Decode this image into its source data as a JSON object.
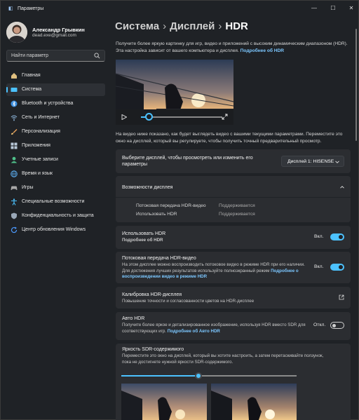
{
  "window": {
    "title": "Параметры"
  },
  "user": {
    "name": "Александр Грывкин",
    "email": "dead.exe@gmail.com"
  },
  "search": {
    "placeholder": "Найти параметр"
  },
  "sidebar": {
    "items": [
      {
        "label": "Главная",
        "icon": "home-icon",
        "color": "#e0c080"
      },
      {
        "label": "Система",
        "icon": "system-icon",
        "color": "#4cc2ff"
      },
      {
        "label": "Bluetooth и устройства",
        "icon": "bluetooth-icon",
        "color": "#3a8dde"
      },
      {
        "label": "Сеть и Интернет",
        "icon": "network-icon",
        "color": "#8fb8de"
      },
      {
        "label": "Персонализация",
        "icon": "brush-icon",
        "color": "#e8a05a"
      },
      {
        "label": "Приложения",
        "icon": "apps-icon",
        "color": "#b8c8d8"
      },
      {
        "label": "Учетные записи",
        "icon": "accounts-icon",
        "color": "#4fc08a"
      },
      {
        "label": "Время и язык",
        "icon": "globe-icon",
        "color": "#5aa8e8"
      },
      {
        "label": "Игры",
        "icon": "gamepad-icon",
        "color": "#a8a8a8"
      },
      {
        "label": "Специальные возможности",
        "icon": "accessibility-icon",
        "color": "#4cc2ff"
      },
      {
        "label": "Конфиденциальность и защита",
        "icon": "shield-icon",
        "color": "#9aa8b8"
      },
      {
        "label": "Центр обновления Windows",
        "icon": "update-icon",
        "color": "#4c9aff"
      }
    ],
    "active_index": 1
  },
  "breadcrumb": {
    "part1": "Система",
    "sep1": "›",
    "part2": "Дисплей",
    "sep2": "›",
    "part3": "HDR"
  },
  "intro": {
    "text": "Получите более яркую картинку для игр, видео и приложений с высоким динамическим диапазоном (HDR). Эта настройка зависит от вашего компьютера и дисплея.",
    "link": "Подробнее об HDR"
  },
  "video": {
    "progress": 0.1
  },
  "preview_text": "На видео ниже показано, как будет выглядеть видео с вашими текущими параметрами. Переместите это окно на дисплей, который вы регулируете, чтобы получить точный предварительный просмотр.",
  "display_select": {
    "label": "Выберите дисплей, чтобы просмотреть или изменить его параметры",
    "value": "Дисплей 1: HISENSE"
  },
  "capabilities": {
    "title": "Возможности дисплея",
    "rows": [
      {
        "label": "Потоковая передача HDR-видео",
        "value": "Поддерживается"
      },
      {
        "label": "Использовать HDR",
        "value": "Поддерживается"
      }
    ]
  },
  "use_hdr": {
    "title": "Использовать HDR",
    "link": "Подробнее об HDR",
    "state": "Вкл.",
    "on": true
  },
  "hdr_stream": {
    "title": "Потоковая передача HDR-видео",
    "desc": "На этом дисплее можно воспроизводить потоковое видео в режиме HDR при его наличии. Для достижения лучших результатов используйте полноэкранный режим",
    "link": "Подробнее о воспроизведении видео в режиме HDR",
    "state": "Вкл.",
    "on": true
  },
  "calibration": {
    "title": "Калибровка HDR-дисплея",
    "desc": "Повышение точности и согласованности цветов на HDR-дисплее",
    "icon": "external-link-icon"
  },
  "auto_hdr": {
    "title": "Авто HDR",
    "desc": "Получите более яркое и детализированное изображение, используя HDR вместо SDR для соответствующих игр.",
    "link": "Подробнее об Авто HDR",
    "state": "Откл.",
    "on": false
  },
  "sdr": {
    "title": "Яркость SDR-содержимого",
    "desc": "Переместите это окно на дисплей, который вы хотите настроить, а затем перетаскивайте ползунок, пока не достигнете нужной яркости SDR-содержимого.",
    "level": 0.44
  },
  "colors": {
    "accent": "#4cc2ff",
    "background": "#1f2226",
    "card": "#2b2d31",
    "link": "#7cc7ff"
  }
}
